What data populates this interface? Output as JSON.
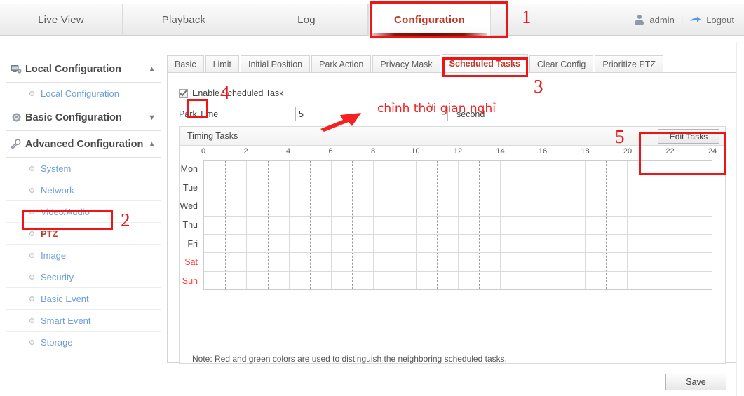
{
  "topnav": {
    "tabs": [
      {
        "label": "Live View",
        "active": false
      },
      {
        "label": "Playback",
        "active": false
      },
      {
        "label": "Log",
        "active": false
      },
      {
        "label": "Configuration",
        "active": true
      }
    ],
    "user": {
      "name": "admin",
      "separator": "|",
      "logout_label": "Logout",
      "avatar_icon": "person-icon",
      "logout_icon": "logout-arrow-icon"
    }
  },
  "sidebar": {
    "groups": [
      {
        "label": "Local Configuration",
        "icon": "monitor-icon",
        "caret": "▲",
        "expanded": true,
        "items": [
          {
            "label": "Local Configuration",
            "selected": false
          }
        ]
      },
      {
        "label": "Basic Configuration",
        "icon": "gear-icon",
        "caret": "▼",
        "expanded": false,
        "items": []
      },
      {
        "label": "Advanced Configuration",
        "icon": "wrench-icon",
        "caret": "▲",
        "expanded": true,
        "items": [
          {
            "label": "System",
            "selected": false
          },
          {
            "label": "Network",
            "selected": false
          },
          {
            "label": "Video/Audio",
            "selected": false
          },
          {
            "label": "PTZ",
            "selected": true
          },
          {
            "label": "Image",
            "selected": false
          },
          {
            "label": "Security",
            "selected": false
          },
          {
            "label": "Basic Event",
            "selected": false
          },
          {
            "label": "Smart Event",
            "selected": false
          },
          {
            "label": "Storage",
            "selected": false
          }
        ]
      }
    ]
  },
  "main": {
    "tabs": [
      {
        "label": "Basic",
        "active": false
      },
      {
        "label": "Limit",
        "active": false
      },
      {
        "label": "Initial Position",
        "active": false
      },
      {
        "label": "Park Action",
        "active": false
      },
      {
        "label": "Privacy Mask",
        "active": false
      },
      {
        "label": "Scheduled Tasks",
        "active": true
      },
      {
        "label": "Clear Config",
        "active": false
      },
      {
        "label": "Prioritize PTZ",
        "active": false
      }
    ],
    "enable_checkbox": {
      "label": "Enable Scheduled Task",
      "checked": true
    },
    "park_time": {
      "label": "Park Time",
      "value": "5",
      "unit": "second"
    },
    "timing_tasks": {
      "title": "Timing Tasks",
      "edit_button": "Edit Tasks"
    },
    "note": "Note: Red and green colors are used to distinguish the neighboring scheduled tasks.",
    "save_button": "Save"
  },
  "chart_data": {
    "type": "heatmap",
    "title": "Timing Tasks",
    "xlabel": "",
    "ylabel": "",
    "hour_ticks": [
      "0",
      "2",
      "4",
      "6",
      "8",
      "10",
      "12",
      "14",
      "16",
      "18",
      "20",
      "22",
      "24"
    ],
    "hour_values": [
      0,
      2,
      4,
      6,
      8,
      10,
      12,
      14,
      16,
      18,
      20,
      22,
      24
    ],
    "xlim": [
      0,
      24
    ],
    "grid": true,
    "days": [
      {
        "label": "Mon",
        "weekend": false,
        "tasks": []
      },
      {
        "label": "Tue",
        "weekend": false,
        "tasks": []
      },
      {
        "label": "Wed",
        "weekend": false,
        "tasks": []
      },
      {
        "label": "Thu",
        "weekend": false,
        "tasks": []
      },
      {
        "label": "Fri",
        "weekend": false,
        "tasks": []
      },
      {
        "label": "Sat",
        "weekend": true,
        "tasks": []
      },
      {
        "label": "Sun",
        "weekend": true,
        "tasks": []
      }
    ],
    "legend": []
  },
  "annotations": {
    "numbers": [
      {
        "id": "1",
        "text": "1"
      },
      {
        "id": "2",
        "text": "2"
      },
      {
        "id": "3",
        "text": "3"
      },
      {
        "id": "4",
        "text": "4"
      },
      {
        "id": "5",
        "text": "5"
      }
    ],
    "note_text": "chỉnh thời gian nghỉ",
    "color": "#f01414"
  },
  "colors": {
    "accent_red": "#c0392b",
    "annotation_red": "#f01414",
    "link_blue": "#6f9fd8",
    "weekend_red": "#ff4040"
  }
}
